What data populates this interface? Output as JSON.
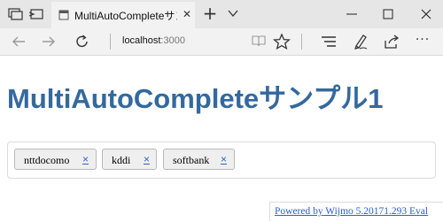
{
  "browser": {
    "tab": {
      "title": "MultiAutoCompleteサンプル",
      "close_symbol": "✕"
    },
    "new_tab_symbol": "+",
    "address": {
      "host": "localhost",
      "port": ":3000"
    },
    "more_symbol": "···"
  },
  "page": {
    "title": "MultiAutoCompleteサンプル1",
    "title_color": "#34699e"
  },
  "autocomplete": {
    "tokens": [
      {
        "label": "nttdocomo",
        "remove": "×"
      },
      {
        "label": "kddi",
        "remove": "×"
      },
      {
        "label": "softbank",
        "remove": "×"
      }
    ],
    "input_value": ""
  },
  "footer": {
    "link_text": "Powered by Wijmo 5.20171.293 Eval"
  },
  "icons": {
    "tab_actions": "tab-actions-icon",
    "set_aside_tabs": "set-aside-tabs-icon",
    "favicon": "page-favicon-icon",
    "back": "arrow-left-icon",
    "forward": "arrow-right-icon",
    "refresh": "refresh-icon",
    "reading_view": "book-icon",
    "favorite": "star-icon",
    "hub": "hub-lines-icon",
    "notes": "pen-icon",
    "share": "share-icon"
  }
}
